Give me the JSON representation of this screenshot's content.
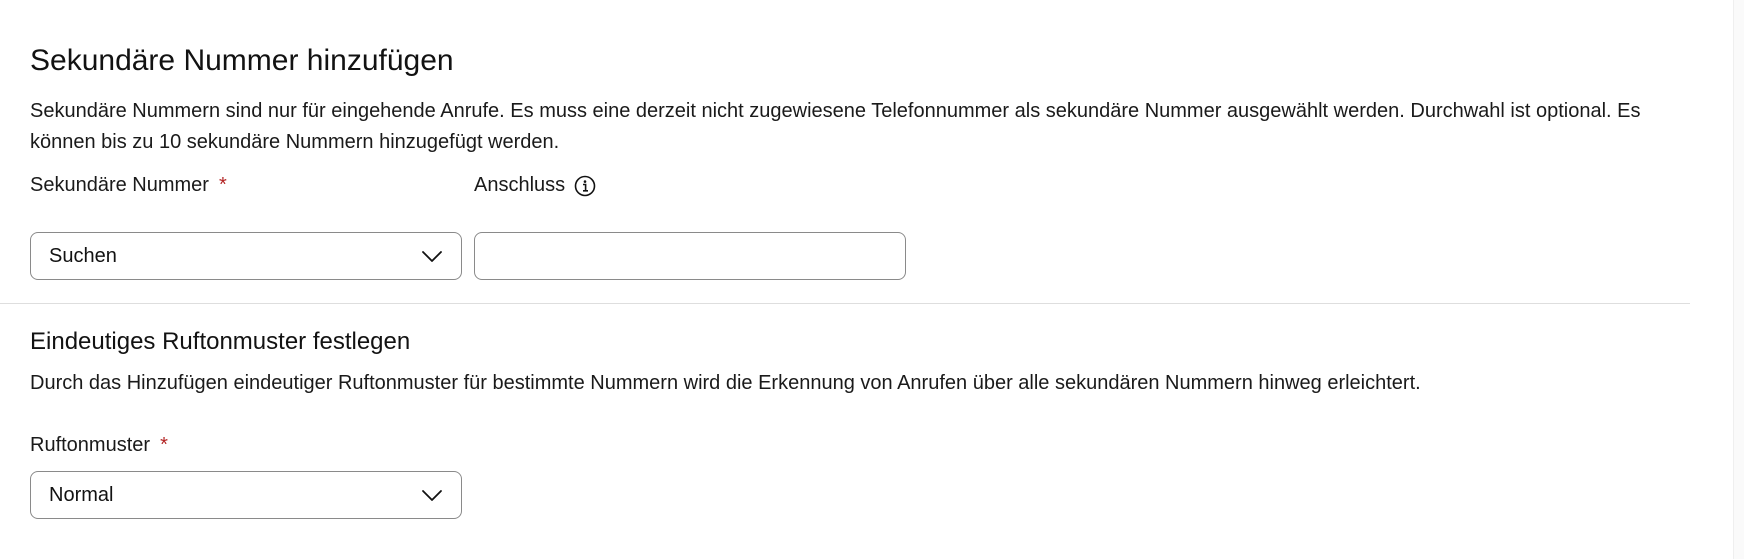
{
  "secondary_number_section": {
    "title": "Sekundäre Nummer hinzufügen",
    "description": "Sekundäre Nummern sind nur für eingehende Anrufe. Es muss eine derzeit nicht zugewiesene Telefonnummer als sekundäre Nummer ausgewählt werden. Durchwahl ist optional. Es können bis zu 10 sekundäre Nummern hinzugefügt werden.",
    "secondary_number_label": "Sekundäre Nummer",
    "required_marker": "*",
    "secondary_number_select_value": "Suchen",
    "extension_label": "Anschluss",
    "extension_value": "",
    "icons": {
      "info": "info-icon",
      "chevron": "chevron-down-icon"
    }
  },
  "ringtone_section": {
    "title": "Eindeutiges Ruftonmuster festlegen",
    "description": "Durch das Hinzufügen eindeutiger Ruftonmuster für bestimmte Nummern wird die Erkennung von Anrufen über alle sekundären Nummern hinweg erleichtert.",
    "ringtone_label": "Ruftonmuster",
    "required_marker": "*",
    "ringtone_select_value": "Normal"
  },
  "colors": {
    "required": "#b32424",
    "border": "#8a8a8a",
    "divider": "#dedede",
    "text": "#121212"
  }
}
